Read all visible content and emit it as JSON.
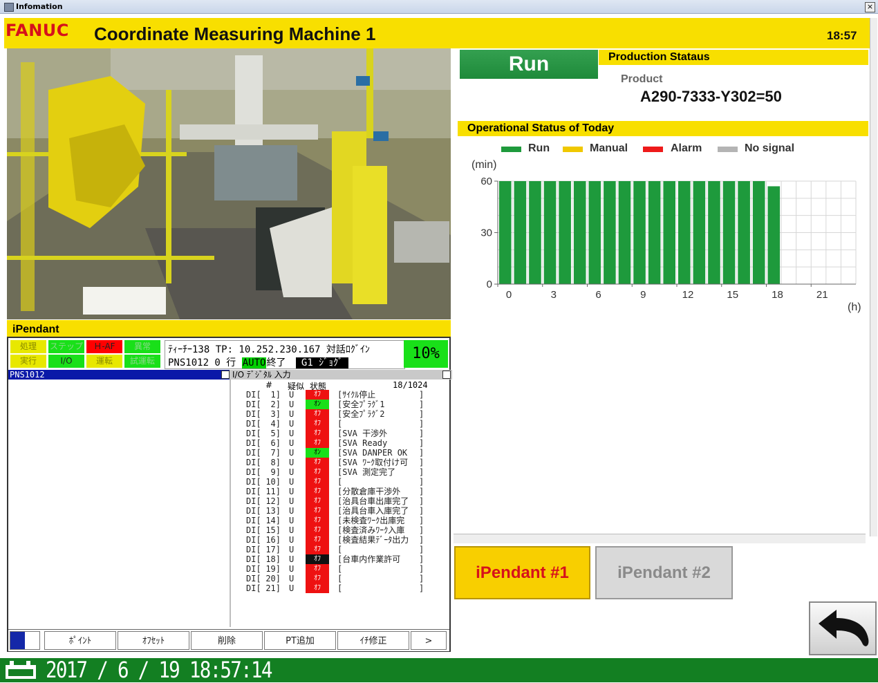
{
  "window": {
    "title": "Infomation",
    "close_label": "×"
  },
  "header": {
    "logo": "FANUC",
    "title": "Coordinate Measuring Machine 1",
    "time": "18:57"
  },
  "ipendant": {
    "label": "iPendant",
    "status_buttons": [
      {
        "label": "処理",
        "color": "#e8e800",
        "text_color": "#8a8a00"
      },
      {
        "label": "ステップ",
        "color": "#19e019",
        "text_color": "#8ad88a"
      },
      {
        "label": "Ｈ-AF",
        "color": "#ff0000",
        "text_color": "#222222"
      },
      {
        "label": "異常",
        "color": "#19e019",
        "text_color": "#8ad88a"
      },
      {
        "label": "実行",
        "color": "#e8e800",
        "text_color": "#8a8a00"
      },
      {
        "label": "I/O",
        "color": "#19e019",
        "text_color": "#222222"
      },
      {
        "label": "運転",
        "color": "#e8e800",
        "text_color": "#8a8a00"
      },
      {
        "label": "試運転",
        "color": "#19e019",
        "text_color": "#8ad88a"
      }
    ],
    "status_line1": "ﾃｨｰﾁｰ138 TP: 10.252.230.167 対話ﾛｸﾞｲﾝ",
    "status_line2_prefix": "PNS1012 0 行",
    "auto_tag": "AUTO",
    "status_line2_mid": "終了",
    "g1_tag": "G1 ｼﾞｮｸﾞ",
    "override": "10%",
    "left_window_title": "PNS1012",
    "right_window_title": "I/O ﾃﾞｼﾞﾀﾙ 入力",
    "io_header": {
      "hash": "#",
      "sim": "疑似",
      "state": "状態",
      "page": "18/1024"
    },
    "io_rows": [
      {
        "type": "DI[",
        "num": "1]",
        "sim": "U",
        "state": "ｵﾌ",
        "color": "#ee1111",
        "comment": "[ｻｲｸﾙ停止",
        "end": "]"
      },
      {
        "type": "DI[",
        "num": "2]",
        "sim": "U",
        "state": "ｵﾝ",
        "color": "#19e019",
        "comment": "[安全ﾌﾟﾗｸﾞ1",
        "end": "]"
      },
      {
        "type": "DI[",
        "num": "3]",
        "sim": "U",
        "state": "ｵﾌ",
        "color": "#ee1111",
        "comment": "[安全ﾌﾟﾗｸﾞ2",
        "end": "]"
      },
      {
        "type": "DI[",
        "num": "4]",
        "sim": "U",
        "state": "ｵﾌ",
        "color": "#ee1111",
        "comment": "[",
        "end": "]"
      },
      {
        "type": "DI[",
        "num": "5]",
        "sim": "U",
        "state": "ｵﾌ",
        "color": "#ee1111",
        "comment": "[SVA 干渉外",
        "end": "]"
      },
      {
        "type": "DI[",
        "num": "6]",
        "sim": "U",
        "state": "ｵﾌ",
        "color": "#ee1111",
        "comment": "[SVA Ready",
        "end": "]"
      },
      {
        "type": "DI[",
        "num": "7]",
        "sim": "U",
        "state": "ｵﾝ",
        "color": "#19e019",
        "comment": "[SVA DANPER OK",
        "end": "]"
      },
      {
        "type": "DI[",
        "num": "8]",
        "sim": "U",
        "state": "ｵﾌ",
        "color": "#ee1111",
        "comment": "[SVA ﾜｰｸ取付け可",
        "end": "]"
      },
      {
        "type": "DI[",
        "num": "9]",
        "sim": "U",
        "state": "ｵﾌ",
        "color": "#ee1111",
        "comment": "[SVA 測定完了",
        "end": "]"
      },
      {
        "type": "DI[",
        "num": "10]",
        "sim": "U",
        "state": "ｵﾌ",
        "color": "#ee1111",
        "comment": "[",
        "end": "]"
      },
      {
        "type": "DI[",
        "num": "11]",
        "sim": "U",
        "state": "ｵﾌ",
        "color": "#ee1111",
        "comment": "[分散倉庫干渉外",
        "end": "]"
      },
      {
        "type": "DI[",
        "num": "12]",
        "sim": "U",
        "state": "ｵﾌ",
        "color": "#ee1111",
        "comment": "[治具台車出庫完了",
        "end": "]"
      },
      {
        "type": "DI[",
        "num": "13]",
        "sim": "U",
        "state": "ｵﾌ",
        "color": "#ee1111",
        "comment": "[治具台車入庫完了",
        "end": "]"
      },
      {
        "type": "DI[",
        "num": "14]",
        "sim": "U",
        "state": "ｵﾌ",
        "color": "#ee1111",
        "comment": "[未検査ﾜｰｸ出庫完",
        "end": "]"
      },
      {
        "type": "DI[",
        "num": "15]",
        "sim": "U",
        "state": "ｵﾌ",
        "color": "#ee1111",
        "comment": "[検査済みﾜｰｸ入庫",
        "end": "]"
      },
      {
        "type": "DI[",
        "num": "16]",
        "sim": "U",
        "state": "ｵﾌ",
        "color": "#ee1111",
        "comment": "[検査結果ﾃﾞｰﾀ出力",
        "end": "]"
      },
      {
        "type": "DI[",
        "num": "17]",
        "sim": "U",
        "state": "ｵﾌ",
        "color": "#ee1111",
        "comment": "[",
        "end": "]"
      },
      {
        "type": "DI[",
        "num": "18]",
        "sim": "U",
        "state": "ｵﾌ",
        "color": "#111111",
        "comment": "[台車内作業許可",
        "end": "]"
      },
      {
        "type": "DI[",
        "num": "19]",
        "sim": "U",
        "state": "ｵﾌ",
        "color": "#ee1111",
        "comment": "[",
        "end": "]"
      },
      {
        "type": "DI[",
        "num": "20]",
        "sim": "U",
        "state": "ｵﾌ",
        "color": "#ee1111",
        "comment": "[",
        "end": "]"
      },
      {
        "type": "DI[",
        "num": "21]",
        "sim": "U",
        "state": "ｵﾌ",
        "color": "#ee1111",
        "comment": "[",
        "end": "]"
      }
    ],
    "function_keys": [
      "ﾎﾟｲﾝﾄ",
      "ｵﾌｾｯﾄ",
      "削除",
      "PT追加",
      "ｲﾁ修正",
      ">"
    ]
  },
  "production": {
    "state": "Run",
    "title": "Production Stataus",
    "product_label": "Product",
    "product_value": "A290-7333-Y302=50"
  },
  "operational": {
    "title": "Operational Status of Today"
  },
  "colors": {
    "run": "#1e9a3c",
    "manual": "#f0c800",
    "alarm": "#ee1a1a",
    "nosignal": "#b4b4b4",
    "yellow": "#f8df00"
  },
  "chart_data": {
    "type": "bar",
    "legend": [
      {
        "name": "Run",
        "color": "#1e9a3c"
      },
      {
        "name": "Manual",
        "color": "#f0c800"
      },
      {
        "name": "Alarm",
        "color": "#ee1a1a"
      },
      {
        "name": "No signal",
        "color": "#b4b4b4"
      }
    ],
    "legend_position": "top",
    "ylabel": "(min)",
    "xlabel": "(h)",
    "ylim": [
      0,
      60
    ],
    "yticks": [
      0,
      30,
      60
    ],
    "xlim": [
      0,
      24
    ],
    "xticks": [
      0,
      3,
      6,
      9,
      12,
      15,
      18,
      21
    ],
    "grid": true,
    "x": [
      0,
      1,
      2,
      3,
      4,
      5,
      6,
      7,
      8,
      9,
      10,
      11,
      12,
      13,
      14,
      15,
      16,
      17,
      18
    ],
    "series": [
      {
        "name": "Run",
        "values": [
          60,
          60,
          60,
          60,
          60,
          60,
          60,
          60,
          60,
          60,
          60,
          60,
          60,
          60,
          60,
          60,
          60,
          60,
          57
        ]
      }
    ]
  },
  "buttons": {
    "ipendant1": "iPendant #1",
    "ipendant2": "iPendant #2",
    "back_icon": "back-arrow-icon"
  },
  "footer": {
    "datetime": "2017 / 6 / 19 18:57:14",
    "icon": "calendar-icon"
  }
}
